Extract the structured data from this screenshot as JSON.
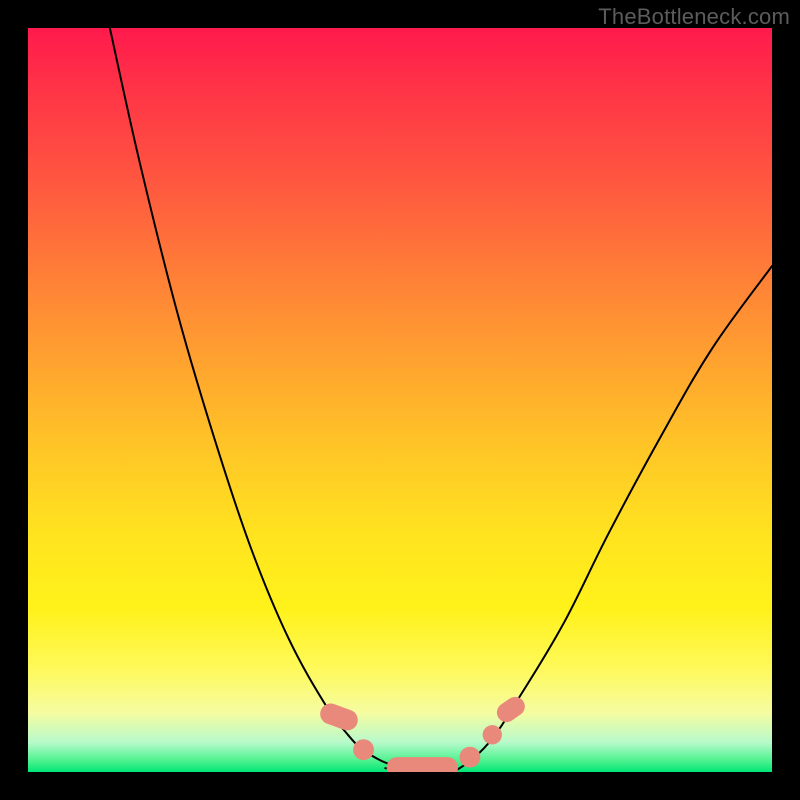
{
  "watermark": "TheBottleneck.com",
  "colors": {
    "frame": "#000000",
    "curve": "#000000",
    "marker": "#e9897b",
    "gradient_top": "#ff1a4d",
    "gradient_bottom": "#00e676"
  },
  "chart_data": {
    "type": "line",
    "title": "",
    "xlabel": "",
    "ylabel": "",
    "xlim": [
      0,
      100
    ],
    "ylim": [
      0,
      100
    ],
    "series": [
      {
        "name": "left-curve",
        "x": [
          11,
          15,
          20,
          25,
          30,
          35,
          40,
          43,
          45,
          47.5,
          50
        ],
        "y": [
          100,
          82,
          62,
          45,
          30,
          18,
          9,
          5,
          3,
          1.5,
          0.5
        ]
      },
      {
        "name": "right-curve",
        "x": [
          58,
          62,
          66,
          72,
          78,
          85,
          92,
          100
        ],
        "y": [
          0.5,
          4,
          10,
          20,
          32,
          45,
          57,
          68
        ]
      },
      {
        "name": "valley-floor",
        "x": [
          48,
          50,
          52,
          54,
          56,
          58
        ],
        "y": [
          0.5,
          0.3,
          0.3,
          0.3,
          0.3,
          0.5
        ]
      }
    ],
    "markers": [
      {
        "shape": "pill",
        "cx": 41.8,
        "cy": 7.4,
        "rx": 1.4,
        "ry": 2.6,
        "angle": -70
      },
      {
        "shape": "round",
        "cx": 45.1,
        "cy": 3.0,
        "r": 1.4
      },
      {
        "shape": "pill",
        "cx": 53.0,
        "cy": 0.6,
        "rx": 4.8,
        "ry": 1.4,
        "angle": 0
      },
      {
        "shape": "round",
        "cx": 59.4,
        "cy": 2.0,
        "r": 1.4
      },
      {
        "shape": "round",
        "cx": 62.4,
        "cy": 5.0,
        "r": 1.3
      },
      {
        "shape": "pill",
        "cx": 64.9,
        "cy": 8.4,
        "rx": 1.3,
        "ry": 2.0,
        "angle": 55
      }
    ]
  }
}
